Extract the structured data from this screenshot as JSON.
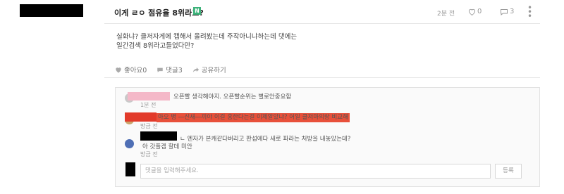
{
  "post": {
    "title": "이게 ㄹㅇ 점유율 8위라고?",
    "badge": "N",
    "time": "2분 전",
    "likes": "0",
    "comments": "3",
    "body_line1": "실화냐? 클저자게에 캡해서 올려봤는데 주작아니냐하는데 댓에는",
    "body_line2": "일간검색 8위라고들었다만?"
  },
  "actions": {
    "like": "좋아요0",
    "comment": "댓글3",
    "share": "공유하기"
  },
  "comments": [
    {
      "text": "오픈빨 생각해야지. 오픈빨순위는 별로안중요함",
      "time": "1분 전"
    },
    {
      "text": "아오 병 ―신새―끼야 이걸 홍한다는걸 이제알았냐? 어일 클저마의랑 비교해",
      "time": "방금 전"
    },
    {
      "text": "ㄴ 엔자가 본캐같다버리고 판섭에다 새로 파라는 처방을 내놓았는데?",
      "reply": "아 갓플겜 할데 미안",
      "time": "방금 전"
    }
  ],
  "input": {
    "placeholder": "댓글을 입력해주세요.",
    "submit": "등록"
  },
  "colors": {
    "badge": "#3db27a",
    "redact_pink": "#f4b8c8",
    "redact_red": "#e23a2a"
  }
}
